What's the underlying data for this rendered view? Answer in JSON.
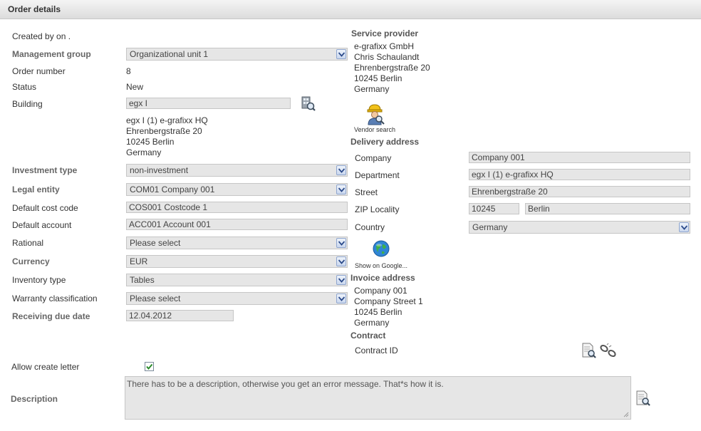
{
  "window": {
    "title": "Order details"
  },
  "left": {
    "created_by": "Created by on .",
    "management_group": {
      "label": "Management group",
      "value": "Organizational unit 1"
    },
    "order_number": {
      "label": "Order number",
      "value": "8"
    },
    "status": {
      "label": "Status",
      "value": "New"
    },
    "building": {
      "label": "Building",
      "value": "egx I",
      "address": [
        "egx I (1) e-grafixx HQ",
        "Ehrenbergstraße 20",
        "10245 Berlin",
        "Germany"
      ]
    },
    "investment_type": {
      "label": "Investment type",
      "value": "non-investment"
    },
    "legal_entity": {
      "label": "Legal entity",
      "value": "COM01 Company 001"
    },
    "default_cost_code": {
      "label": "Default cost code",
      "value": "COS001 Costcode 1"
    },
    "default_account": {
      "label": "Default account",
      "value": "ACC001 Account 001"
    },
    "rational": {
      "label": "Rational",
      "value": "Please select"
    },
    "currency": {
      "label": "Currency",
      "value": "EUR"
    },
    "inventory_type": {
      "label": "Inventory type",
      "value": "Tables"
    },
    "warranty_classification": {
      "label": "Warranty classification",
      "value": "Please select"
    },
    "receiving_due_date": {
      "label": "Receiving due date",
      "value": "12.04.2012"
    },
    "allow_create_letter": {
      "label": "Allow create letter",
      "checked": true
    },
    "description": {
      "label": "Description",
      "value": "There has to be a description, otherwise you get an error message. That*s how it is."
    }
  },
  "right": {
    "service_provider": {
      "heading": "Service provider",
      "lines": [
        "e-grafixx GmbH",
        "Chris Schaulandt",
        "Ehrenbergstraße 20",
        "10245 Berlin",
        "Germany"
      ],
      "vendor_search_label": "Vendor search"
    },
    "delivery_address": {
      "heading": "Delivery address",
      "company": {
        "label": "Company",
        "value": "Company 001"
      },
      "department": {
        "label": "Department",
        "value": "egx I (1) e-grafixx HQ"
      },
      "street": {
        "label": "Street",
        "value": "Ehrenbergstraße 20"
      },
      "zip_locality": {
        "label": "ZIP Locality",
        "zip": "10245",
        "locality": "Berlin"
      },
      "country": {
        "label": "Country",
        "value": "Germany"
      },
      "show_on_google_label": "Show on Google..."
    },
    "invoice_address": {
      "heading": "Invoice address",
      "lines": [
        "Company 001",
        "Company Street 1",
        "10245 Berlin",
        "Germany"
      ]
    },
    "contract": {
      "heading": "Contract",
      "id_label": "Contract ID"
    }
  },
  "icons": {
    "building_search": "building-search-icon",
    "vendor_search": "vendor-search-icon",
    "globe": "globe-icon",
    "contract_search": "document-search-icon",
    "contract_unlink": "unlink-icon",
    "description_search": "document-search-icon"
  },
  "colors": {
    "field_bg": "#e6e6e6",
    "label_bold": "#666666",
    "arrow_border": "#8fa6cf",
    "check": "#2a8a2a"
  }
}
